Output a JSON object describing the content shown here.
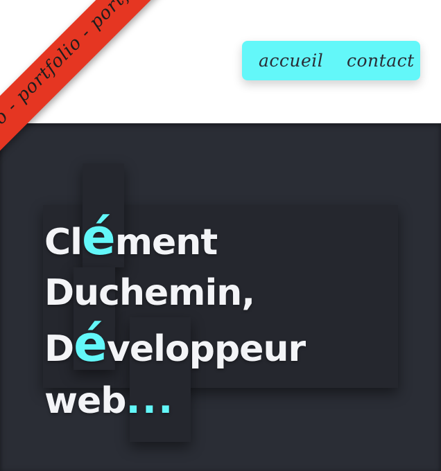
{
  "ribbon": {
    "text": "portfolio - portfolio - portfolio - p"
  },
  "nav": {
    "items": [
      {
        "label": "accueil"
      },
      {
        "label": "contact"
      }
    ]
  },
  "hero": {
    "line1_pre": "Cl",
    "line1_accent": "é",
    "line1_post": "ment",
    "line2": "Duchemin,",
    "line3_pre": "D",
    "line3_accent": "é",
    "line3_post": "veloppeur",
    "line4_pre": "web",
    "line4_accent": "..."
  },
  "colors": {
    "accent": "#63f7f9",
    "ribbon": "#e53622",
    "hero_bg": "#2a2d35",
    "header_bg": "#ffffff",
    "text_light": "#f3f4f7",
    "nav_text": "#2a2d36"
  }
}
